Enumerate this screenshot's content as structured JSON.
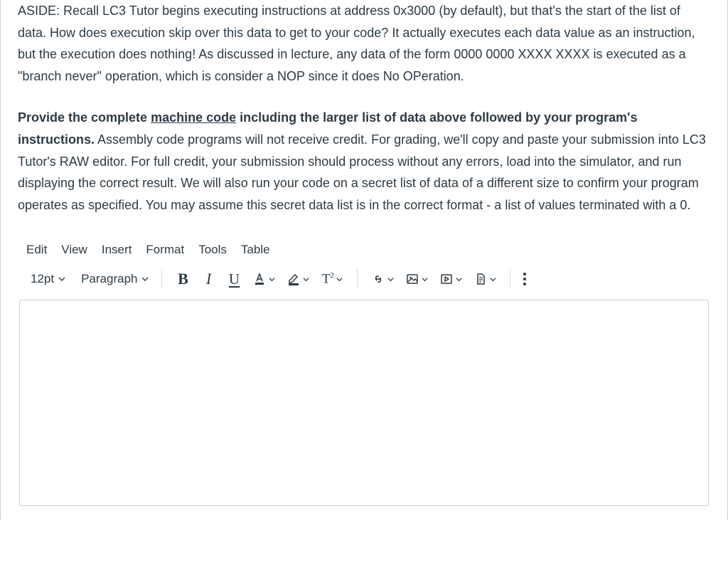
{
  "question": {
    "paragraph_aside": "ASIDE: Recall LC3 Tutor begins executing instructions at address 0x3000 (by default), but that's the start of the list of data. How does execution skip over this data to get to your code? It actually executes each data value as an instruction, but the execution does nothing! As discussed in lecture, any data of the form 0000 0000 XXXX XXXX is executed as a \"branch never\" operation, which is consider a NOP since it does No OPeration.",
    "paragraph_submit_bold_pre": "Provide the complete ",
    "paragraph_submit_bold_u": "machine code",
    "paragraph_submit_bold_post": " including the larger list of data above followed by your program's instructions.",
    "paragraph_submit_rest": " Assembly code programs will not receive credit. For grading, we'll copy and paste your submission into LC3 Tutor's RAW editor. For full credit, your submission should process without any errors, load into the simulator, and run displaying the correct result. We will also run your code on a secret list of data of a different size to confirm your program operates as specified. You may assume this secret data list is in the correct format - a list of values terminated with a 0."
  },
  "editor": {
    "menubar": {
      "edit": "Edit",
      "view": "View",
      "insert": "Insert",
      "format": "Format",
      "tools": "Tools",
      "table": "Table"
    },
    "toolbar": {
      "font_size": "12pt",
      "block_format": "Paragraph",
      "bold": "B",
      "italic": "I",
      "underline": "U"
    }
  }
}
